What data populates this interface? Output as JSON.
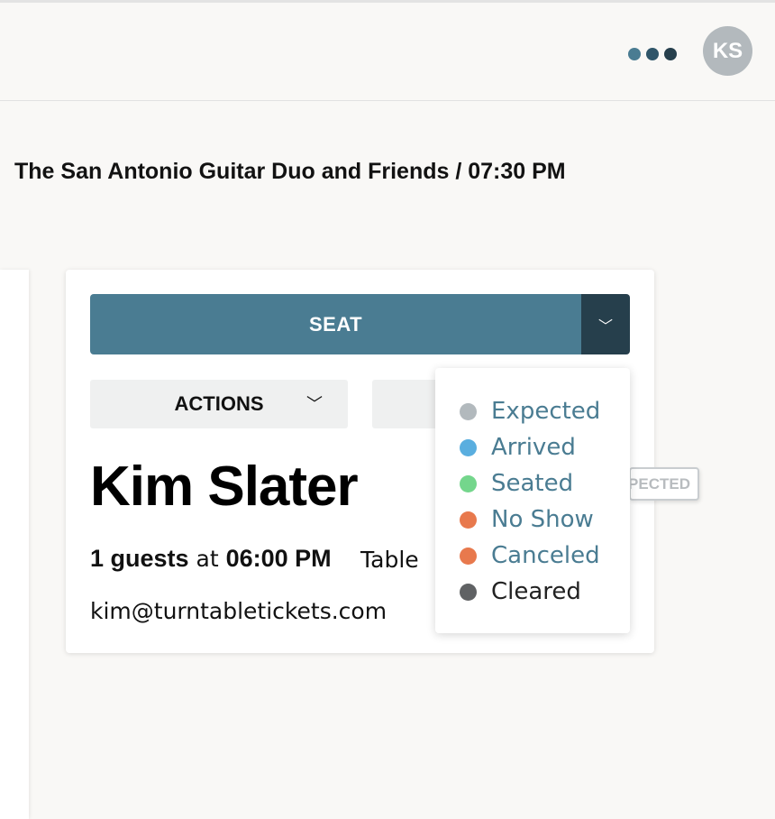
{
  "header": {
    "menu_dot_colors": [
      "#4a7c92",
      "#2f5569",
      "#263f4c"
    ],
    "avatar_initials": "KS",
    "menu_icon": "more-dots-icon"
  },
  "page": {
    "title": "The San Antonio Guitar Duo and Friends / 07:30 PM"
  },
  "reservation": {
    "seat_label": "SEAT",
    "seat_toggle_icon": "chevron-down-icon",
    "seat_toggle_glyph": "﹀",
    "actions_label": "ACTIONS",
    "actions_glyph": "﹀",
    "guest_name": "Kim Slater",
    "status_badge": "EXPECTED",
    "guests_count": "1 guests",
    "at_word": "at",
    "time": "06:00 PM",
    "table_label": "Table",
    "email": "kim@turntabletickets.com"
  },
  "status_menu": {
    "items": [
      {
        "label": "Expected",
        "color": "#b2b9bd"
      },
      {
        "label": "Arrived",
        "color": "#5aaedf"
      },
      {
        "label": "Seated",
        "color": "#74d68c"
      },
      {
        "label": "No Show",
        "color": "#e8794d"
      },
      {
        "label": "Canceled",
        "color": "#e8794d"
      },
      {
        "label": "Cleared",
        "color": "#606264"
      }
    ]
  },
  "colors": {
    "primary": "#4a7c92",
    "primary_dark": "#263f4c",
    "background": "#f9f8f6"
  }
}
